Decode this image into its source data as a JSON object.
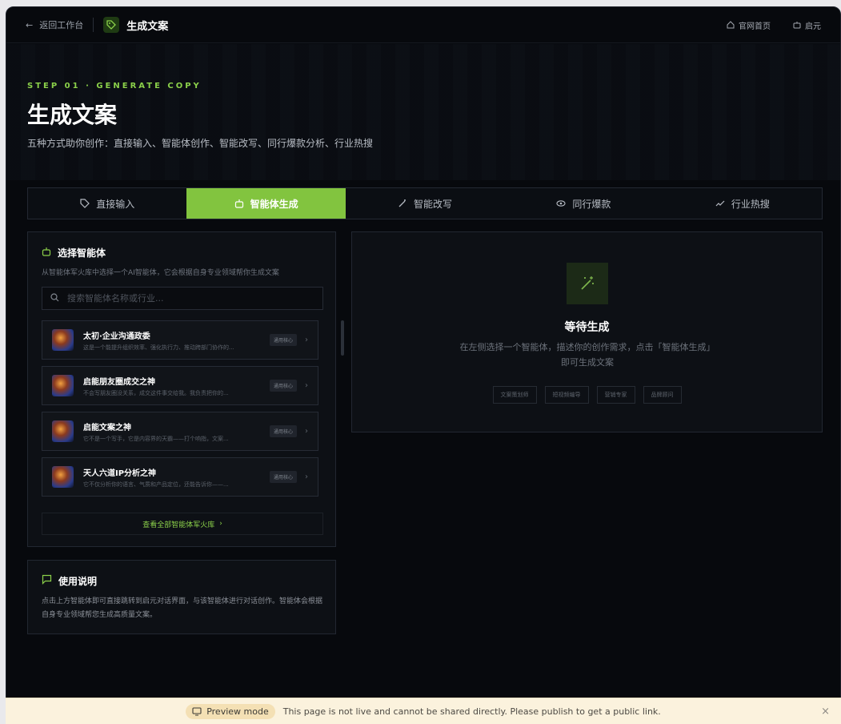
{
  "topbar": {
    "back_label": "返回工作台",
    "title": "生成文案",
    "links": [
      {
        "icon": "home-icon",
        "label": "官网首页"
      },
      {
        "icon": "robot-icon",
        "label": "启元"
      }
    ]
  },
  "hero": {
    "step": "STEP 01 · GENERATE COPY",
    "title": "生成文案",
    "subtitle": "五种方式助你创作：直接输入、智能体创作、智能改写、同行爆款分析、行业热搜"
  },
  "tabs": [
    {
      "label": "直接输入",
      "icon": "tag-icon",
      "active": false
    },
    {
      "label": "智能体生成",
      "icon": "robot-icon",
      "active": true
    },
    {
      "label": "智能改写",
      "icon": "wand-icon",
      "active": false
    },
    {
      "label": "同行爆款",
      "icon": "eye-icon",
      "active": false
    },
    {
      "label": "行业热搜",
      "icon": "trending-icon",
      "active": false
    }
  ],
  "agent_panel": {
    "title": "选择智能体",
    "description": "从智能体军火库中选择一个AI智能体，它会根据自身专业领域帮你生成文案",
    "search_placeholder": "搜索智能体名称或行业...",
    "agents": [
      {
        "name": "太初·企业沟通政委",
        "desc": "这是一个能提升组织效率、强化执行力、推动跨部门协作的...",
        "badge": "通用核心"
      },
      {
        "name": "启能朋友圈成交之神",
        "desc": "不会写朋友圈没关系，成交这件事交给我。我负责把你的...",
        "badge": "通用核心"
      },
      {
        "name": "启能文案之神",
        "desc": "它不是一个写手，它是内容界的天霸——打个响指，文案...",
        "badge": "通用核心"
      },
      {
        "name": "天人六道IP分析之神",
        "desc": "它不仅分析你的语言、气质和产品定位，还能告诉你——...",
        "badge": "通用核心"
      }
    ],
    "view_all": "查看全部智能体军火库"
  },
  "result_panel": {
    "title": "等待生成",
    "description": "在左侧选择一个智能体，描述你的创作需求，点击「智能体生成」即可生成文案",
    "chips": [
      "文案策划师",
      "短视频编导",
      "营销专家",
      "品牌顾问"
    ]
  },
  "usage_panel": {
    "title": "使用说明",
    "text": "点击上方智能体即可直接跳转到启元对话界面，与该智能体进行对话创作。智能体会根据自身专业领域帮您生成高质量文案。"
  },
  "preview_bar": {
    "pill": "Preview mode",
    "message": "This page is not live and cannot be shared directly. Please publish to get a public link."
  }
}
